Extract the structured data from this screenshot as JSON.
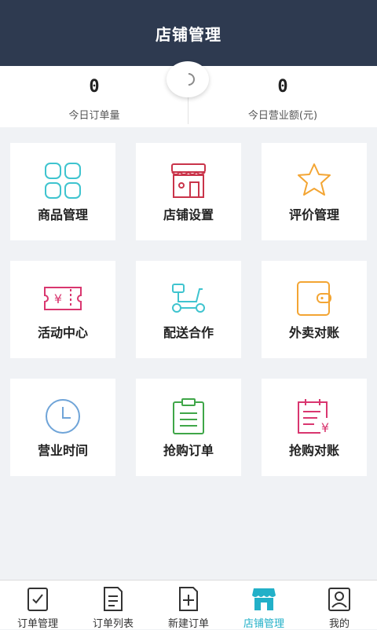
{
  "header": {
    "title": "店铺管理"
  },
  "stats": {
    "orders_today": {
      "value": "0",
      "label": "今日订单量"
    },
    "revenue_today": {
      "value": "0",
      "label": "今日营业额(元)"
    }
  },
  "grid": {
    "tiles": [
      {
        "label": "商品管理",
        "icon": "grid-icon",
        "color": "#3fc4cf"
      },
      {
        "label": "店铺设置",
        "icon": "store-icon",
        "color": "#c9344a"
      },
      {
        "label": "评价管理",
        "icon": "star-icon",
        "color": "#f3a533"
      },
      {
        "label": "活动中心",
        "icon": "ticket-icon",
        "color": "#d9366f"
      },
      {
        "label": "配送合作",
        "icon": "scooter-icon",
        "color": "#3fc4cf"
      },
      {
        "label": "外卖对账",
        "icon": "wallet-icon",
        "color": "#f3a533"
      },
      {
        "label": "营业时间",
        "icon": "clock-icon",
        "color": "#6fa4d8"
      },
      {
        "label": "抢购订单",
        "icon": "clipboard-icon",
        "color": "#3fa648"
      },
      {
        "label": "抢购对账",
        "icon": "calendar-yen-icon",
        "color": "#d9366f"
      }
    ]
  },
  "tabbar": {
    "active": 3,
    "tabs": [
      {
        "label": "订单管理",
        "icon": "order-check-icon"
      },
      {
        "label": "订单列表",
        "icon": "list-icon"
      },
      {
        "label": "新建订单",
        "icon": "new-order-icon"
      },
      {
        "label": "店铺管理",
        "icon": "shop-icon"
      },
      {
        "label": "我的",
        "icon": "profile-icon"
      }
    ]
  },
  "colors": {
    "header_bg": "#2e3a50",
    "accent": "#22b0c8"
  }
}
